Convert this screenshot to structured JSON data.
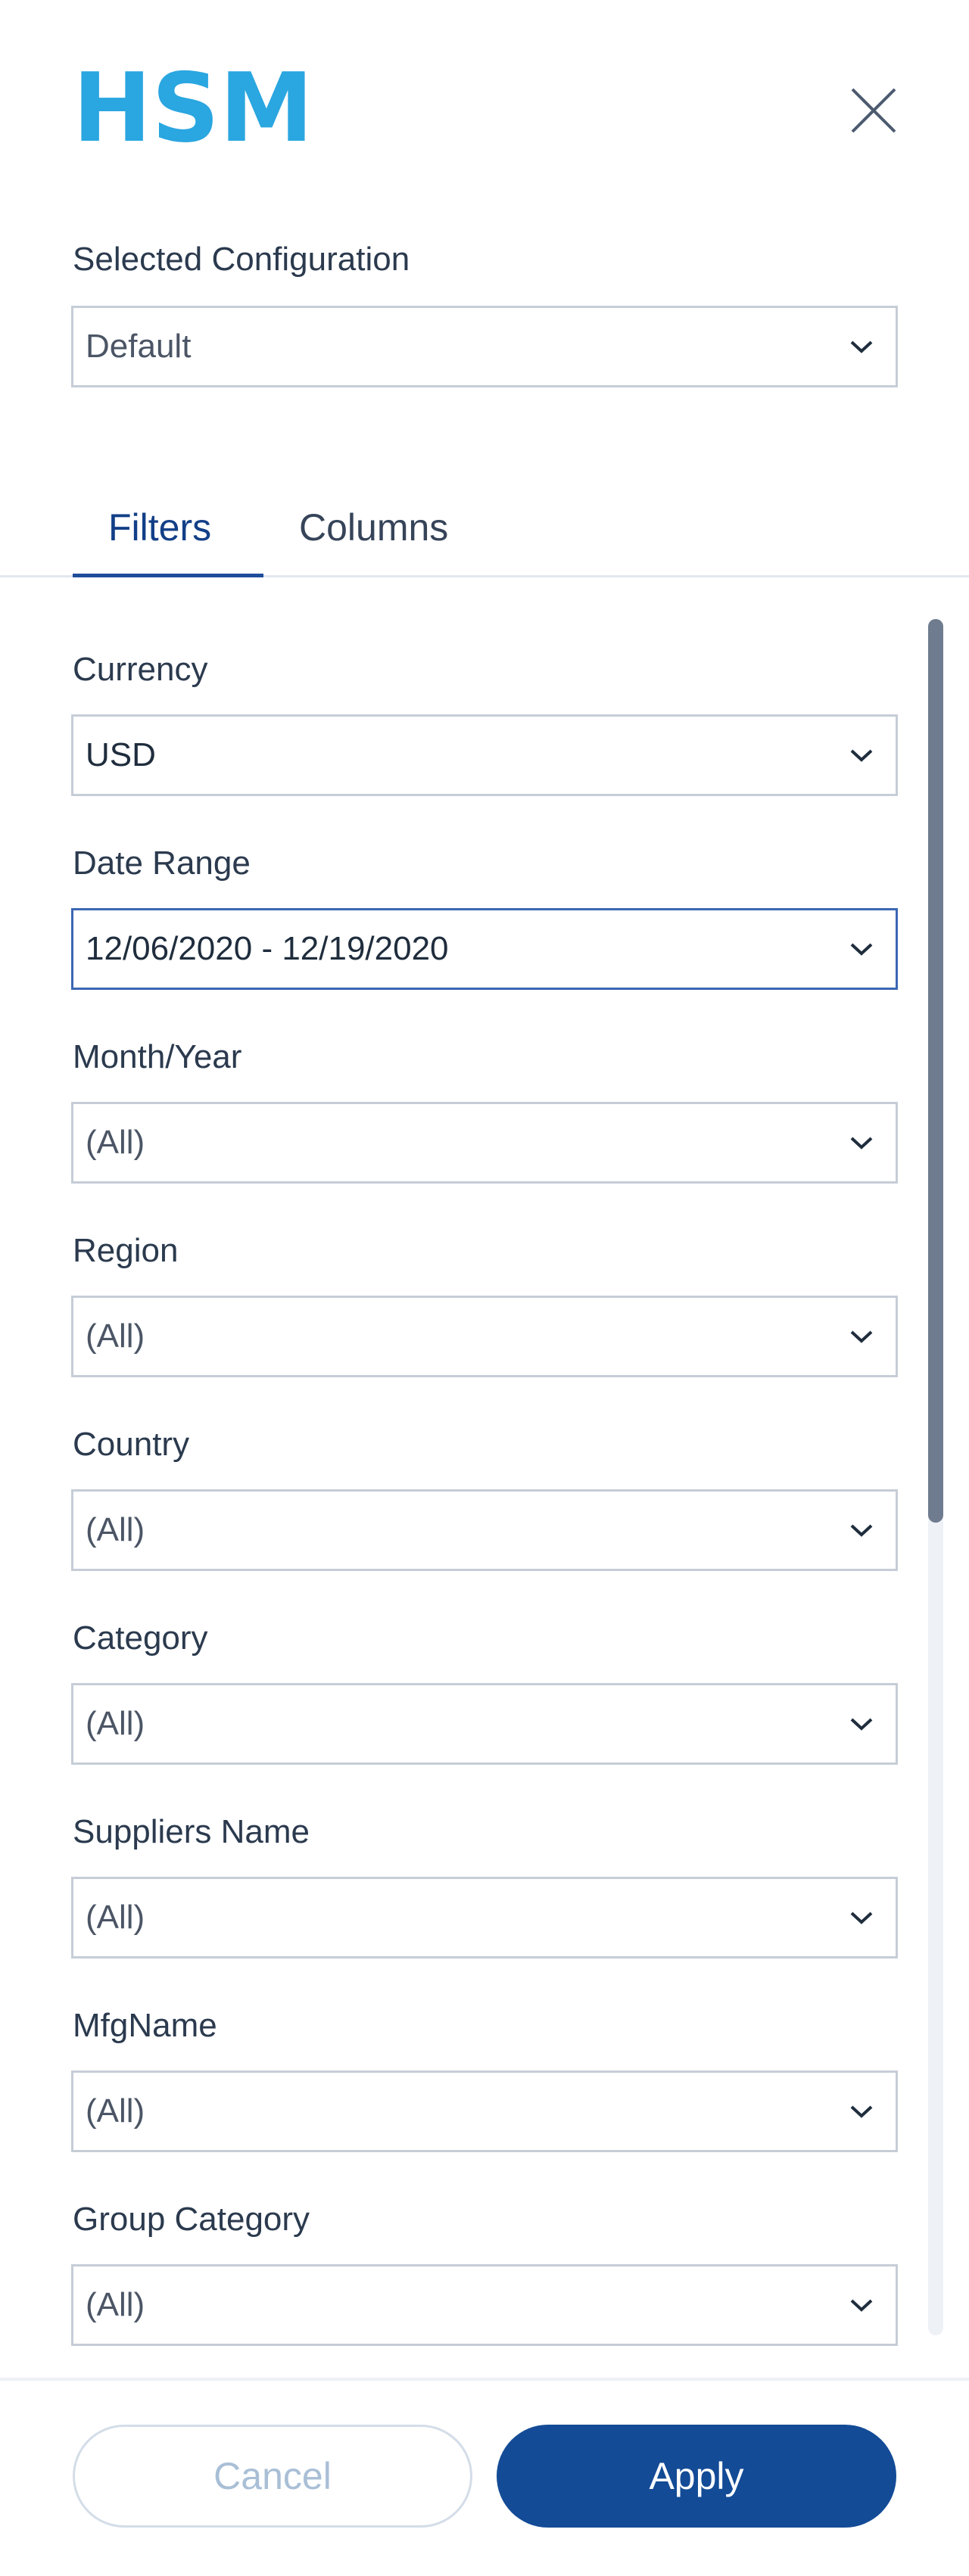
{
  "header": {
    "logo_text": "HSM",
    "brand_color": "#2aa6e0",
    "close_icon": "close-icon"
  },
  "configuration": {
    "label": "Selected Configuration",
    "value": "Default"
  },
  "tabs": [
    {
      "label": "Filters",
      "active": true
    },
    {
      "label": "Columns",
      "active": false
    }
  ],
  "filters": [
    {
      "label": "Currency",
      "value": "USD"
    },
    {
      "label": "Date Range",
      "value": "12/06/2020 - 12/19/2020",
      "focused": true
    },
    {
      "label": "Month/Year",
      "value": "(All)"
    },
    {
      "label": "Region",
      "value": "(All)"
    },
    {
      "label": "Country",
      "value": "(All)"
    },
    {
      "label": "Category",
      "value": "(All)"
    },
    {
      "label": "Suppliers Name",
      "value": "(All)"
    },
    {
      "label": "MfgName",
      "value": "(All)"
    },
    {
      "label": "Group Category",
      "value": "(All)"
    }
  ],
  "footer": {
    "cancel_label": "Cancel",
    "apply_label": "Apply"
  },
  "colors": {
    "accent": "#134b96",
    "tab_active": "#123f87",
    "border": "#c6cdd7",
    "focus_border": "#3b67b3"
  }
}
